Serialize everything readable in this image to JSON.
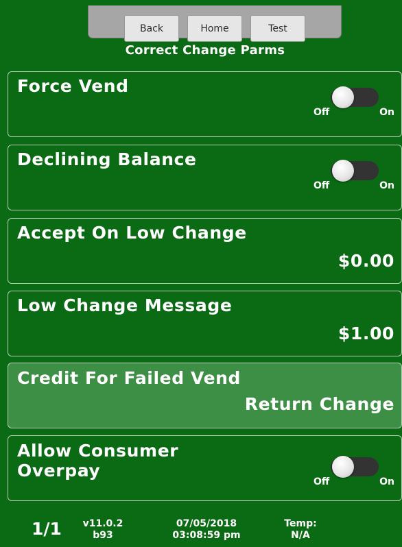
{
  "nav": {
    "back_label": "Back",
    "home_label": "Home",
    "test_label": "Test"
  },
  "page_title": "Correct Change Parms",
  "rows": [
    {
      "label": "Force Vend",
      "type": "toggle",
      "state": "off",
      "off_label": "Off",
      "on_label": "On"
    },
    {
      "label": "Declining Balance",
      "type": "toggle",
      "state": "off",
      "off_label": "Off",
      "on_label": "On"
    },
    {
      "label": "Accept On Low Change",
      "type": "value",
      "value": "$0.00"
    },
    {
      "label": "Low Change Message",
      "type": "value",
      "value": "$1.00"
    },
    {
      "label": "Credit For Failed Vend",
      "type": "value",
      "value": "Return Change",
      "selected": true
    },
    {
      "label_line1": "Allow Consumer",
      "label_line2": "Overpay",
      "type": "toggle",
      "state": "off",
      "off_label": "Off",
      "on_label": "On"
    }
  ],
  "footer": {
    "page": "1/1",
    "version": "v11.0.2",
    "build": "b93",
    "date": "07/05/2018",
    "time": "03:08:59 pm",
    "temp_label": "Temp:",
    "temp_value": "N/A"
  },
  "colors": {
    "background": "#0b6a14",
    "selected_row": "#3d8f45",
    "nav_tray": "#a6a6a6",
    "nav_button": "#e6e6e6",
    "toggle_track": "#333333"
  },
  "icons": {
    "toggle": "toggle-switch-icon"
  }
}
